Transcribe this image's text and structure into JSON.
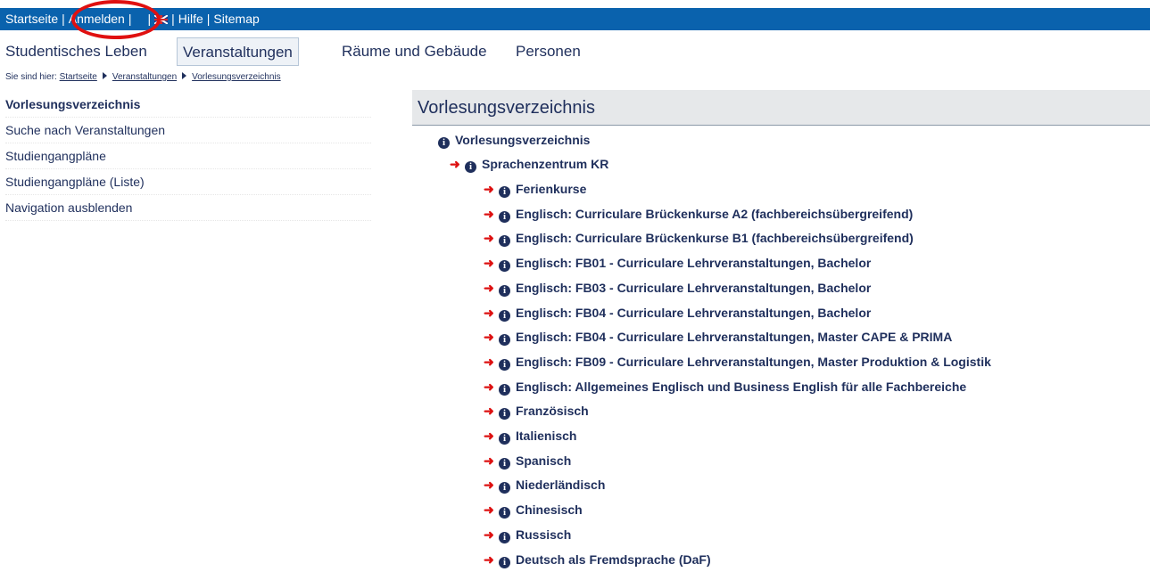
{
  "topbar": {
    "startseite": "Startseite",
    "anmelden": "Anmelden",
    "hilfe": "Hilfe",
    "sitemap": "Sitemap",
    "sep": "|",
    "flag_icon": "uk-flag-icon"
  },
  "mainnav": {
    "items": [
      "Studentisches Leben",
      "Veranstaltungen",
      "Räume und Gebäude",
      "Personen"
    ],
    "active": "Veranstaltungen"
  },
  "breadcrumb": {
    "prefix": "Sie sind hier:",
    "items": [
      "Startseite",
      "Veranstaltungen",
      "Vorlesungsverzeichnis"
    ]
  },
  "sidebar": {
    "items": [
      "Vorlesungsverzeichnis",
      "Suche nach Veranstaltungen",
      "Studiengangpläne",
      "Studiengangpläne (Liste)",
      "Navigation ausblenden"
    ],
    "active": "Vorlesungsverzeichnis"
  },
  "panel": {
    "title": "Vorlesungsverzeichnis",
    "root": "Vorlesungsverzeichnis",
    "section": "Sprachenzentrum KR",
    "children": [
      "Ferienkurse",
      "Englisch: Curriculare Brückenkurse A2 (fachbereichsübergreifend)",
      "Englisch: Curriculare Brückenkurse B1 (fachbereichsübergreifend)",
      "Englisch: FB01 - Curriculare Lehrveranstaltungen, Bachelor",
      "Englisch: FB03 - Curriculare Lehrveranstaltungen, Bachelor",
      "Englisch: FB04 - Curriculare Lehrveranstaltungen, Bachelor",
      "Englisch: FB04 - Curriculare Lehrveranstaltungen, Master CAPE & PRIMA",
      "Englisch: FB09 - Curriculare Lehrveranstaltungen, Master Produktion & Logistik",
      "Englisch: Allgemeines Englisch und Business English für alle Fachbereiche",
      "Französisch",
      "Italienisch",
      "Spanisch",
      "Niederländisch",
      "Chinesisch",
      "Russisch",
      "Deutsch als Fremdsprache (DaF)"
    ]
  },
  "colors": {
    "topbar": "#0a62ad",
    "arrow": "#dd1111",
    "text": "#1f2f5c",
    "highlight_circle": "#e01010"
  }
}
